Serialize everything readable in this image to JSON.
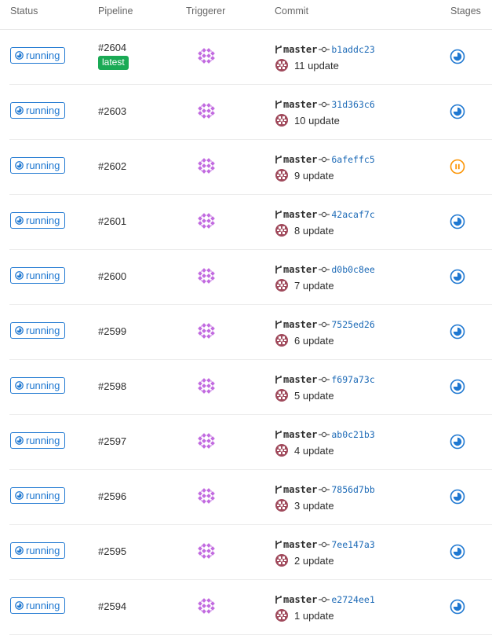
{
  "header": {
    "status": "Status",
    "pipeline": "Pipeline",
    "triggerer": "Triggerer",
    "commit": "Commit",
    "stages": "Stages"
  },
  "colors": {
    "running": "#1f78d1",
    "manual_paused": "#fc9403",
    "latest_badge": "#1aaa55",
    "sha_link": "#1b69b6"
  },
  "rows": [
    {
      "status": "running",
      "id": "#2604",
      "badge": "latest",
      "branch": "master",
      "sha": "b1addc23",
      "message": "11 update",
      "stage": "running"
    },
    {
      "status": "running",
      "id": "#2603",
      "branch": "master",
      "sha": "31d363c6",
      "message": "10 update",
      "stage": "running"
    },
    {
      "status": "running",
      "id": "#2602",
      "branch": "master",
      "sha": "6afeffc5",
      "message": "9 update",
      "stage": "paused"
    },
    {
      "status": "running",
      "id": "#2601",
      "branch": "master",
      "sha": "42acaf7c",
      "message": "8 update",
      "stage": "running"
    },
    {
      "status": "running",
      "id": "#2600",
      "branch": "master",
      "sha": "d0b0c8ee",
      "message": "7 update",
      "stage": "running"
    },
    {
      "status": "running",
      "id": "#2599",
      "branch": "master",
      "sha": "7525ed26",
      "message": "6 update",
      "stage": "running"
    },
    {
      "status": "running",
      "id": "#2598",
      "branch": "master",
      "sha": "f697a73c",
      "message": "5 update",
      "stage": "running"
    },
    {
      "status": "running",
      "id": "#2597",
      "branch": "master",
      "sha": "ab0c21b3",
      "message": "4 update",
      "stage": "running"
    },
    {
      "status": "running",
      "id": "#2596",
      "branch": "master",
      "sha": "7856d7bb",
      "message": "3 update",
      "stage": "running"
    },
    {
      "status": "running",
      "id": "#2595",
      "branch": "master",
      "sha": "7ee147a3",
      "message": "2 update",
      "stage": "running"
    },
    {
      "status": "running",
      "id": "#2594",
      "branch": "master",
      "sha": "e2724ee1",
      "message": "1 update",
      "stage": "running"
    }
  ]
}
